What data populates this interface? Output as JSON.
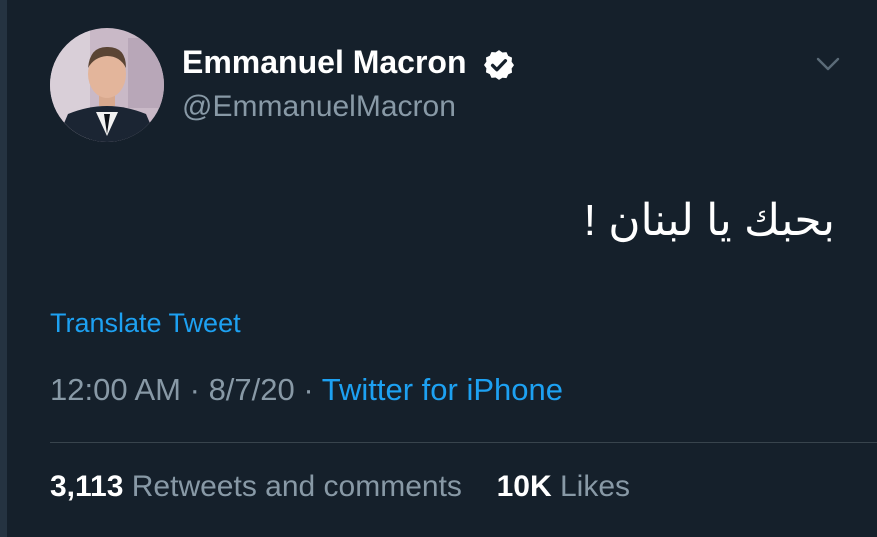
{
  "tweet": {
    "display_name": "Emmanuel Macron",
    "handle": "@EmmanuelMacron",
    "text": "بحبك يا لبنان !",
    "translate_label": "Translate Tweet",
    "time": "12:00 AM",
    "date": "8/7/20",
    "separator": "·",
    "source": "Twitter for iPhone",
    "retweets_count": "3,113",
    "retweets_label": "Retweets and comments",
    "likes_count": "10K",
    "likes_label": "Likes"
  },
  "colors": {
    "background": "#15202b",
    "primary_text": "#ffffff",
    "secondary_text": "#8899a6",
    "link": "#1da1f2",
    "divider": "#38444d"
  },
  "icons": {
    "verified": "verified-badge-icon",
    "caret": "chevron-down-icon"
  }
}
